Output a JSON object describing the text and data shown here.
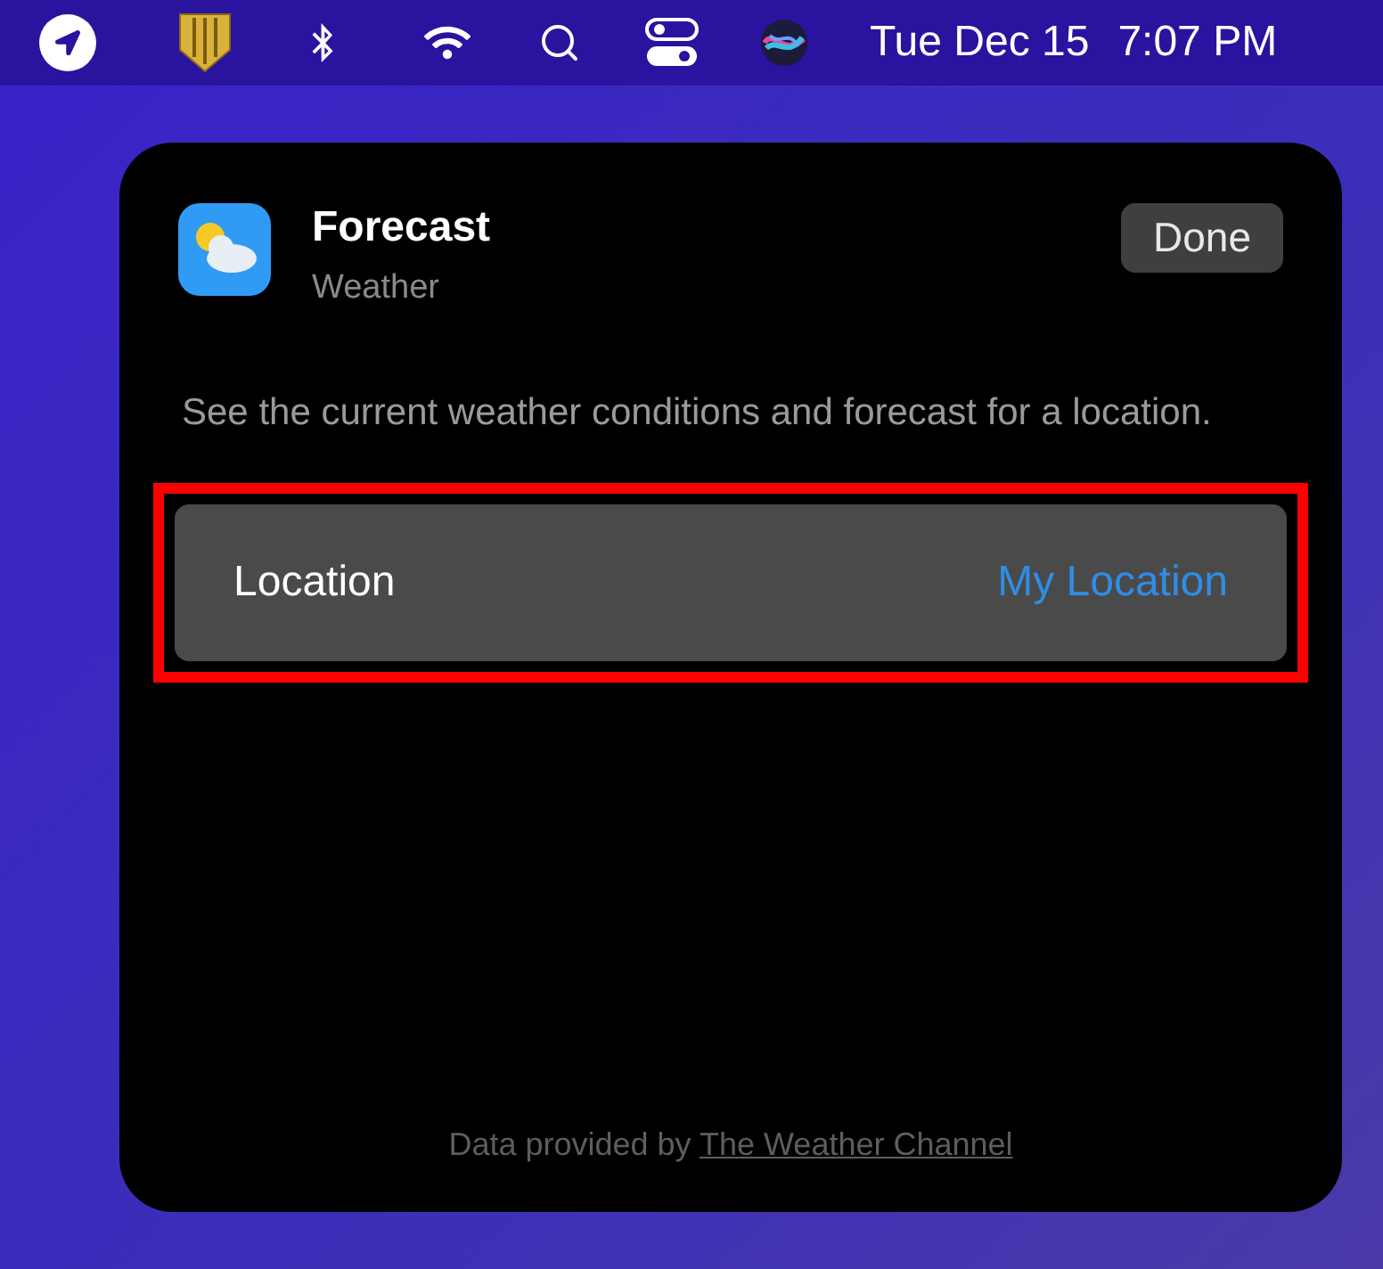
{
  "menu_bar": {
    "date": "Tue Dec 15",
    "time": "7:07 PM"
  },
  "widget": {
    "title": "Forecast",
    "subtitle": "Weather",
    "done_button": "Done",
    "description": "See the current weather conditions and forecast for a location.",
    "setting": {
      "label": "Location",
      "value": "My Location",
      "highlighted": true
    },
    "footer": {
      "text": "Data provided by",
      "link": "The Weather Channel"
    }
  }
}
